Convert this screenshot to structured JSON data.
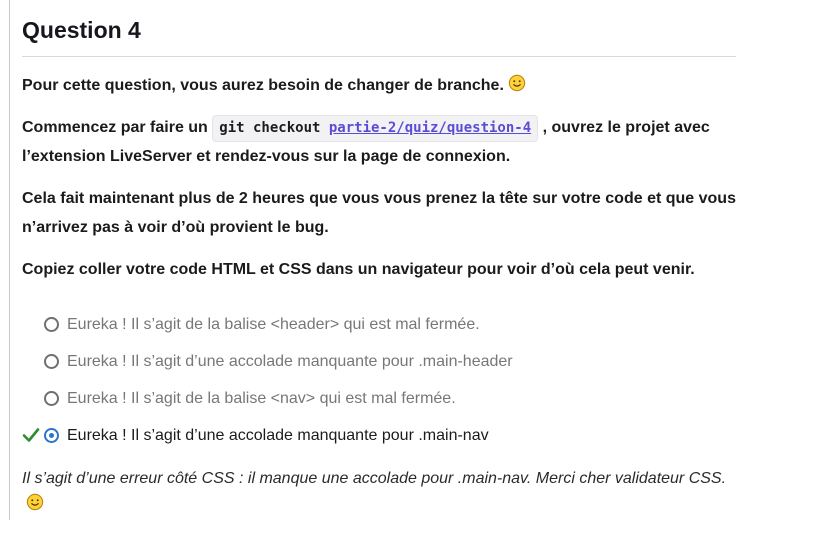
{
  "question": {
    "title": "Question 4",
    "intro": "Pour cette question, vous aurez besoin de changer de branche.",
    "p2_before": "Commencez par faire un ",
    "code_cmd": "git checkout ",
    "code_link": "partie-2/quiz/question-4",
    "p2_after": " , ouvrez le projet avec l’extension LiveServer et rendez-vous sur la page de connexion.",
    "p3": "Cela fait maintenant plus de 2 heures que vous vous prenez la tête sur votre code et que vous n’arrivez pas à voir d’où provient le bug.",
    "p4": "Copiez coller votre code HTML et CSS dans un navigateur pour voir d’où cela peut venir."
  },
  "options": [
    {
      "label": "Eureka ! Il s’agit de la balise <header> qui est mal fermée.",
      "selected": false
    },
    {
      "label": "Eureka ! Il s’agit d’une accolade manquante pour .main-header",
      "selected": false
    },
    {
      "label": "Eureka ! Il s’agit de la balise <nav> qui est mal fermée.",
      "selected": false
    },
    {
      "label": "Eureka ! Il s’agit d’une accolade manquante pour .main-nav",
      "selected": true,
      "correct": true
    }
  ],
  "explanation": "Il s’agit d’une erreur côté CSS : il manque une accolade pour .main-nav. Merci cher validateur CSS.",
  "colors": {
    "accent": "#2b72d1",
    "correct": "#2e8b2e",
    "link": "#5b4cd6"
  },
  "icons": {
    "smiley": "smiley-icon",
    "check": "checkmark-icon"
  }
}
